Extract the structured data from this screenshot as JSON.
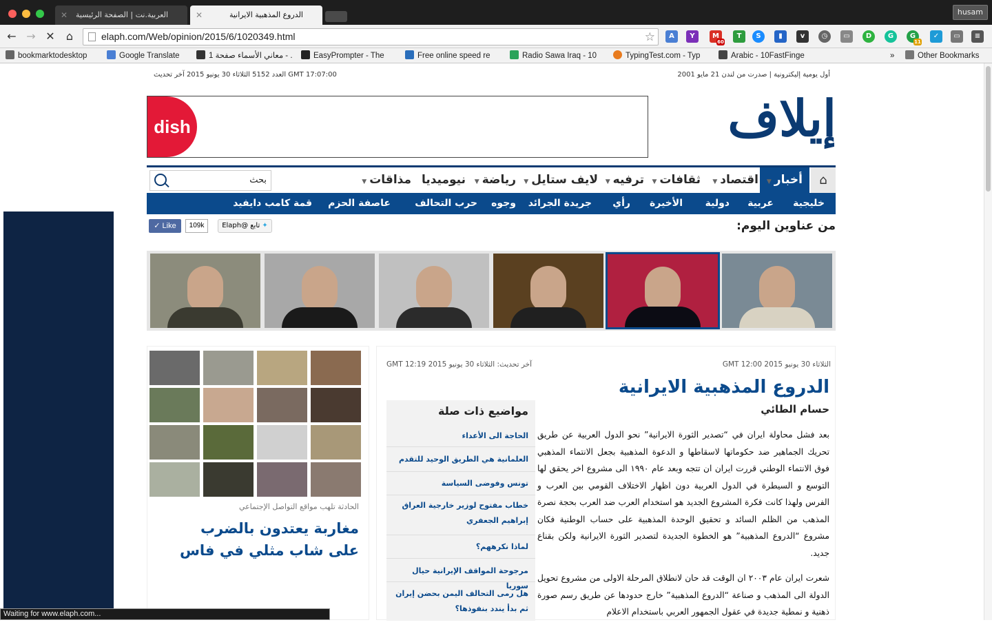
{
  "browser": {
    "tabs": [
      {
        "title": "العربية.نت | الصفحة الرئيسية",
        "active": false
      },
      {
        "title": "الدروع المذهبية الايرانية",
        "active": true
      }
    ],
    "profile": "husam",
    "url": "elaph.com/Web/opinion/2015/6/1020349.html",
    "extensions": [
      "translate-icon",
      "yahoo-icon",
      "gmail-icon",
      "t-icon",
      "shazam-icon",
      "chart-icon",
      "pocket-icon",
      "clock-icon",
      "cast-icon",
      "d-icon",
      "grammarly-icon",
      "g-green-icon",
      "check-icon",
      "window-icon",
      "menu-icon"
    ],
    "gmail_badge": "60",
    "ext_badge": "11",
    "bookmarks": [
      "bookmarktodesktop",
      "Google Translate",
      "1 معاني الأسماء صفحة - ...",
      "EasyPrompter - The",
      "Free online speed re",
      "Radio Sawa Iraq - 10",
      "TypingTest.com - Typ",
      "Arabic - 10FastFinge"
    ],
    "bookmarks_overflow": "»",
    "other_bookmarks": "Other Bookmarks",
    "status": "Waiting for www.elaph.com..."
  },
  "site": {
    "tagline": "أول يومية إليكترونية | صدرت من لندن 21 مايو 2001",
    "update_line": "GMT 17:07:00  العدد 5152 الثلاثاء 30 يونيو 2015 آخر تحديث",
    "logo": "إيلاف",
    "ad_brand": "dish",
    "nav": [
      {
        "label": "أخبار",
        "active": true
      },
      {
        "label": "اقتصاد"
      },
      {
        "label": "ثقافات"
      },
      {
        "label": "ترفيه"
      },
      {
        "label": "لايف ستايل"
      },
      {
        "label": "رياضة"
      },
      {
        "label": "نيوميديا"
      },
      {
        "label": "مذاقات"
      }
    ],
    "search_placeholder": "بحث",
    "subnav": [
      "خليجية",
      "عربية",
      "دولية",
      "الأخيرة",
      "رأي",
      "جريدة الجرائد",
      "وجوه",
      "حرب التحالف",
      "عاصفة الحزم",
      "قمة كامب دايفيد"
    ],
    "headlines_title": "من عناوين اليوم:",
    "fb_like": "Like",
    "fb_count": "109k",
    "twitter_follow": "تابع @Elaph"
  },
  "article": {
    "published": "الثلاثاء 30 يونيو 2015 GMT 12:00",
    "updated": "آخر تحديث: الثلاثاء 30 يونيو 2015 GMT 12:19",
    "title": "الدروع المذهبية الايرانية",
    "author": "حسام الطائي",
    "paragraphs": [
      "بعد فشل محاولة ايران في “تصدير الثورة الايرانية” نحو الدول العربية عن طريق تحريك الجماهير ضد حكوماتها لاسقاطها و الدعوة المذهبية بجعل الانتماء المذهبي فوق الانتماء الوطني قررت ايران ان تتجه وبعد عام ١٩٩٠ الى مشروع اخر يحقق لها التوسع و السيطرة في الدول العربية دون اظهار الاختلاف القومي بين العرب و الفرس ولهذا كانت فكرة المشروع الجديد هو استخدام العرب ضد العرب بحجة نصرة المذهب من الظلم السائد و تحقيق الوحدة المذهبية على حساب الوطنية فكان مشروع “الدروع المذهبية” هو الخطوة الجديدة لتصدير الثورة الايرانية ولكن بقناع جديد.",
      "شعرت ايران عام ٢٠٠٣ ان الوقت قد حان لانطلاق المرحلة الاولى من مشروع تحويل الدولة الى المذهب و صناعة “الدروع المذهبية” خارج حدودها عن طريق رسم صورة ذهنية و نمطية جديدة في عقول الجمهور العربي باستخدام الاعلام"
    ]
  },
  "related": {
    "title": "مواضيع ذات صلة",
    "items": [
      "الحاجة الى الأعداء",
      "العلمانية هي الطريق الوحيد للتقدم",
      "تونس وفوضى السياسة",
      "خطاب مفتوح لوزير خارجية العراق إبراهيم الجعفري",
      "لماذا نكرههم؟",
      "مرجوحة المواقف الإيرانية حيال سوريا",
      "هل رمى التحالف اليمن بحضن إيران ثم بدأ يندد بنفوذها؟"
    ]
  },
  "sidebar": {
    "caption": "الحادثة تلهب مواقع التواصل الإجتماعي",
    "headline": "مغاربة يعتدون بالضرب على شاب مثلي في فاس"
  },
  "colors": {
    "brand": "#0b4a8c",
    "logo": "#0b3a72",
    "leftbanner": "#0e2444",
    "ad": "#e31937"
  }
}
